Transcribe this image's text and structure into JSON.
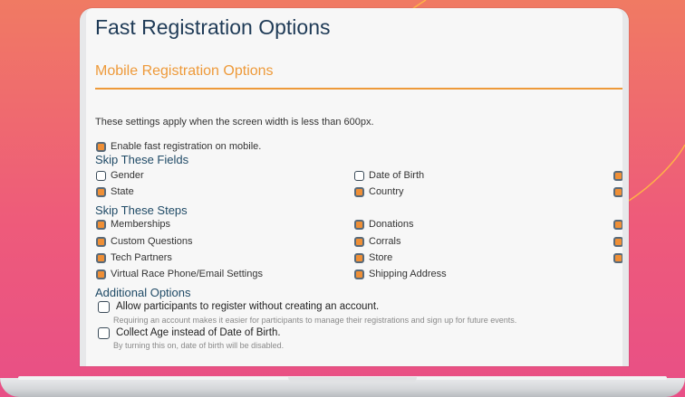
{
  "page": {
    "title": "Fast Registration Options",
    "section_title": "Mobile Registration Options",
    "description": "These settings apply when the screen width is less than 600px."
  },
  "mobile": {
    "enable_label": "Enable fast registration on mobile.",
    "enable_checked": true
  },
  "skip_fields": {
    "title": "Skip These Fields",
    "items": [
      {
        "label": "Gender",
        "checked": false
      },
      {
        "label": "Date of Birth",
        "checked": false
      },
      {
        "label": "State",
        "checked": true
      },
      {
        "label": "Country",
        "checked": true
      }
    ]
  },
  "skip_steps": {
    "title": "Skip These Steps",
    "items": [
      {
        "label": "Memberships",
        "checked": true
      },
      {
        "label": "Donations",
        "checked": true
      },
      {
        "label": "Custom Questions",
        "checked": true
      },
      {
        "label": "Corrals",
        "checked": true
      },
      {
        "label": "Tech Partners",
        "checked": true
      },
      {
        "label": "Store",
        "checked": true
      },
      {
        "label": "Virtual Race Phone/Email Settings",
        "checked": true
      },
      {
        "label": "Shipping Address",
        "checked": true
      }
    ]
  },
  "additional": {
    "title": "Additional Options",
    "no_account_label": "Allow participants to register without creating an account.",
    "no_account_help": "Requiring an account makes it easier for participants to manage their registrations and sign up for future events.",
    "no_account_checked": false,
    "age_label": "Collect Age instead of Date of Birth.",
    "age_help": "By turning this on, date of birth will be disabled.",
    "age_checked": false
  },
  "colors": {
    "accent": "#ef8f36",
    "heading": "#1f3b57",
    "background_top": "#f07a63",
    "background_bottom": "#e84f86"
  }
}
